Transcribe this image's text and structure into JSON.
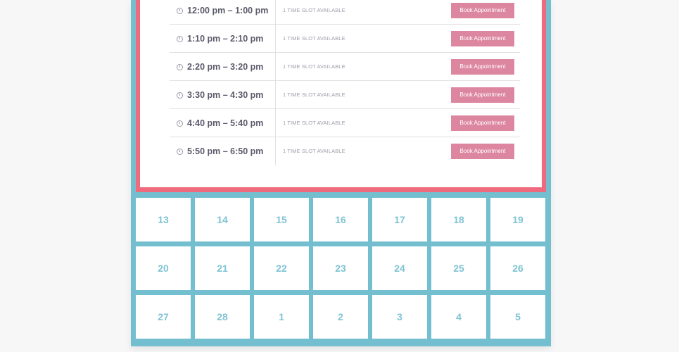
{
  "slots": [
    {
      "time": "12:00 pm – 1:00 pm",
      "status": "1 TIME SLOT AVAILABLE",
      "button": "Book Appointment"
    },
    {
      "time": "1:10 pm – 2:10 pm",
      "status": "1 TIME SLOT AVAILABLE",
      "button": "Book Appointment"
    },
    {
      "time": "2:20 pm – 3:20 pm",
      "status": "1 TIME SLOT AVAILABLE",
      "button": "Book Appointment"
    },
    {
      "time": "3:30 pm – 4:30 pm",
      "status": "1 TIME SLOT AVAILABLE",
      "button": "Book Appointment"
    },
    {
      "time": "4:40 pm – 5:40 pm",
      "status": "1 TIME SLOT AVAILABLE",
      "button": "Book Appointment"
    },
    {
      "time": "5:50 pm – 6:50 pm",
      "status": "1 TIME SLOT AVAILABLE",
      "button": "Book Appointment"
    }
  ],
  "calendar": {
    "weeks": [
      [
        "13",
        "14",
        "15",
        "16",
        "17",
        "18",
        "19"
      ],
      [
        "20",
        "21",
        "22",
        "23",
        "24",
        "25",
        "26"
      ],
      [
        "27",
        "28",
        "1",
        "2",
        "3",
        "4",
        "5"
      ]
    ]
  },
  "colors": {
    "frame": "#73bfcf",
    "panel_border": "#ef6a7c",
    "button": "#dd86a0",
    "day_text": "#7fc3d3"
  },
  "icons": {
    "slot_time": "clock-icon"
  }
}
